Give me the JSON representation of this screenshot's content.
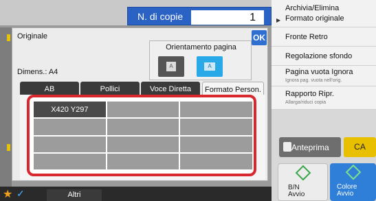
{
  "copies": {
    "label": "N. di copie",
    "value": "1"
  },
  "right_menu": [
    {
      "title": "Archivia/Elimina",
      "title2": "Formato originale",
      "sub": ""
    },
    {
      "title": "Fronte Retro",
      "sub": ""
    },
    {
      "title": "Regolazione sfondo",
      "sub": ""
    },
    {
      "title": "Pagina vuota Ignora",
      "sub": "Ignora pag. vuota nell'orig."
    },
    {
      "title": "Rapporto Ripr.",
      "sub": "Allarga/riduci copia"
    }
  ],
  "preview_label": "Anteprima",
  "ca_label": "CA",
  "bw_start": {
    "line1": "B/N",
    "line2": "Avvio"
  },
  "color_start": {
    "line1": "Colore",
    "line2": "Avvio"
  },
  "bottom": {
    "altri_label": "Altri"
  },
  "dialog": {
    "title": "Originale",
    "ok_label": "OK",
    "orientation_label": "Orientamento pagina",
    "orientation_options": [
      "A",
      "A"
    ],
    "dimens_label": "Dimens.: A4",
    "tabs": [
      "AB",
      "Pollici",
      "Voce Diretta",
      "Formato Person."
    ],
    "active_tab": 3,
    "custom_sizes": [
      "X420 Y297",
      "",
      "",
      "",
      "",
      "",
      "",
      "",
      "",
      "",
      "",
      ""
    ]
  },
  "colors": {
    "accent": "#2b63c4",
    "frame": "#d8282e",
    "ca": "#e8c000"
  }
}
